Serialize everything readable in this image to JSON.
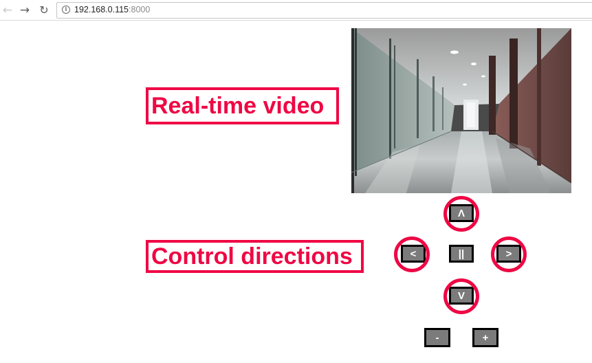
{
  "browser": {
    "url_host": "192.168.0.115",
    "url_port": ":8000",
    "icons": {
      "back": "arrow-left-icon",
      "forward": "arrow-right-icon",
      "reload": "reload-icon",
      "info": "info-icon"
    }
  },
  "annotations": {
    "video_label": "Real-time video",
    "control_label": "Control directions",
    "accent_color": "#ee0844"
  },
  "controls": {
    "up": "Λ",
    "left": "<",
    "stop": "||",
    "right": ">",
    "down": "V",
    "minus": "-",
    "plus": "+",
    "button_color": "#7b7b7b"
  }
}
